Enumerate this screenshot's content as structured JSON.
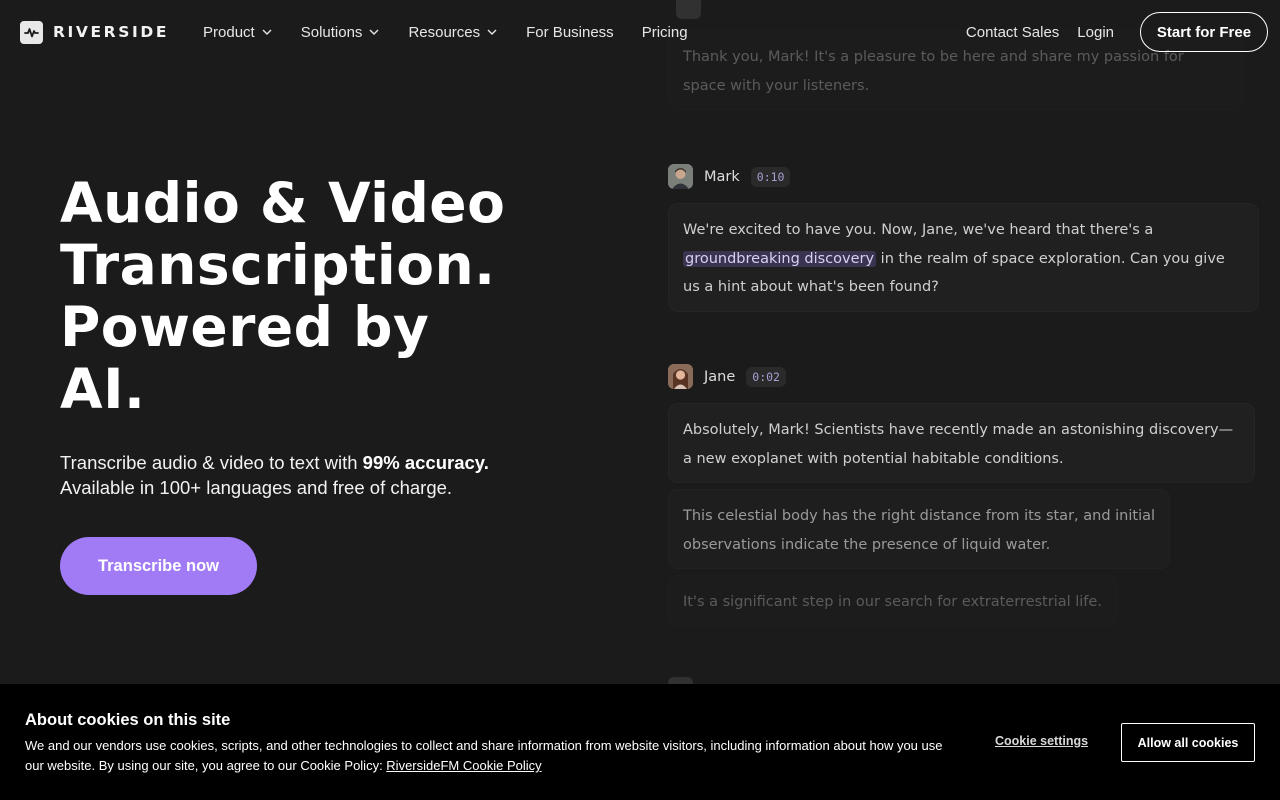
{
  "nav": {
    "logo_text": "RIVERSIDE",
    "items": [
      {
        "label": "Product",
        "dropdown": true
      },
      {
        "label": "Solutions",
        "dropdown": true
      },
      {
        "label": "Resources",
        "dropdown": true
      },
      {
        "label": "For Business",
        "dropdown": false
      },
      {
        "label": "Pricing",
        "dropdown": false
      }
    ],
    "contact_sales": "Contact Sales",
    "login": "Login",
    "start_free": "Start for Free"
  },
  "hero": {
    "title_lines": [
      "Audio & Video",
      "Transcription.",
      "Powered by",
      "AI."
    ],
    "subtitle_prefix": "Transcribe audio & video to text with ",
    "subtitle_bold": "99% accuracy.",
    "subtitle_line2": "Available in 100+ languages and free of charge.",
    "button": "Transcribe now",
    "accent_color": "#a07bf5"
  },
  "transcript": {
    "top_bubble": "Thank you, Mark! It's a pleasure to be here and share my passion for space with your listeners.",
    "mark": {
      "name": "Mark",
      "time": "0:10",
      "text_before": "We're excited to have you. Now, Jane, we've heard that there's a ",
      "highlight": "groundbreaking discovery",
      "text_after": " in the realm of space exploration. Can you give us a hint about what's been found?"
    },
    "jane": {
      "name": "Jane",
      "time": "0:02",
      "bubble1": "Absolutely, Mark! Scientists have recently made an astonishing discovery—a new exoplanet with potential habitable conditions.",
      "bubble2": " This celestial body has the right distance from its star, and initial observations indicate the presence of liquid water.",
      "bubble3": " It's a significant step in our search for extraterrestrial life."
    }
  },
  "cookie": {
    "title": "About cookies on this site",
    "text": "We and our vendors use cookies, scripts, and other technologies to collect and share information from website visitors, including information about how you use our website. By using our site, you agree to our Cookie Policy: ",
    "policy_link": "RiversideFM Cookie Policy",
    "settings": "Cookie settings",
    "allow_all": "Allow all cookies"
  }
}
